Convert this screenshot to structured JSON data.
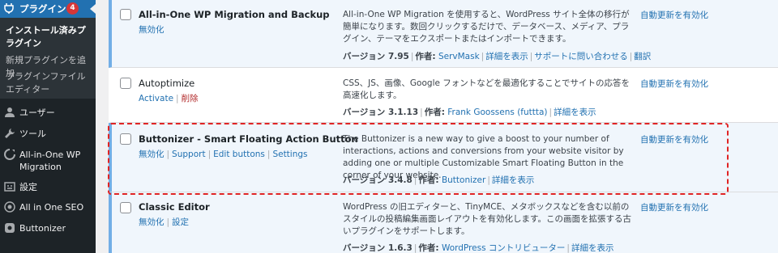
{
  "sidebar": {
    "plugins_label": "プラグイン",
    "plugins_badge": "4",
    "submenu": [
      "インストール済みプラグイン",
      "新規プラグインを追加",
      "プラグインファイルエディター"
    ],
    "items": [
      {
        "label": "ユーザー",
        "icon": "users-icon"
      },
      {
        "label": "ツール",
        "icon": "wrench-icon"
      },
      {
        "label": "All-in-One WP Migration",
        "icon": "migration-icon"
      },
      {
        "label": "設定",
        "icon": "settings-icon"
      },
      {
        "label": "All in One SEO",
        "icon": "seo-icon"
      },
      {
        "label": "Buttonizer",
        "icon": "buttonizer-icon"
      }
    ]
  },
  "plugins": [
    {
      "name": "All-in-One WP Migration and Backup",
      "actions": [
        "無効化"
      ],
      "description": "All-in-One WP Migration を使用すると、WordPress サイト全体の移行が簡単になります。数回クリックするだけで、データベース、メディア、プラグイン、テーマをエクスポートまたはインポートできます。",
      "version": "バージョン 7.95",
      "author_label": "作者:",
      "author": "ServMask",
      "links": [
        "詳細を表示",
        "サポートに問い合わせる",
        "翻訳"
      ],
      "auto_update": "自動更新を有効化"
    },
    {
      "name": "Autoptimize",
      "actions": [
        "Activate",
        "削除"
      ],
      "description": "CSS、JS、画像、Google フォントなどを最適化することでサイトの応答を高速化します。",
      "version": "バージョン 3.1.13",
      "author_label": "作者:",
      "author": "Frank Goossens (futtta)",
      "links": [
        "詳細を表示"
      ],
      "auto_update": "自動更新を有効化"
    },
    {
      "name": "Buttonizer - Smart Floating Action Button",
      "actions": [
        "無効化",
        "Support",
        "Edit buttons",
        "Settings"
      ],
      "description": "The Buttonizer is a new way to give a boost to your number of interactions, actions and conversions from your website visitor by adding one or multiple Customizable Smart Floating Button in the corner of your website.",
      "version": "バージョン 3.4.8",
      "author_label": "作者:",
      "author": "Buttonizer",
      "links": [
        "詳細を表示"
      ],
      "auto_update": "自動更新を有効化"
    },
    {
      "name": "Classic Editor",
      "actions": [
        "無効化",
        "設定"
      ],
      "description": "WordPress の旧エディターと、TinyMCE、メタボックスなどを含む以前のスタイルの投稿編集画面レイアウトを有効化します。この画面を拡張する古いプラグインをサポートします。",
      "version": "バージョン 1.6.3",
      "author_label": "作者:",
      "author": "WordPress コントリビューター",
      "links": [
        "詳細を表示"
      ],
      "auto_update": "自動更新を有効化"
    }
  ],
  "colors": {
    "sidebar_bg": "#1d2327",
    "accent": "#2271b1",
    "badge": "#d63638",
    "highlight": "#e02424",
    "active_row_border": "#72aee6"
  }
}
